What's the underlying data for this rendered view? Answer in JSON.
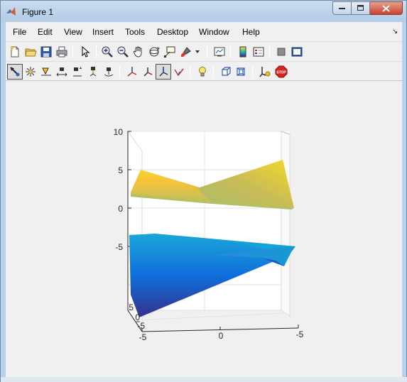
{
  "window": {
    "title": "Figure 1"
  },
  "menu": [
    "File",
    "Edit",
    "View",
    "Insert",
    "Tools",
    "Desktop",
    "Window",
    "Help"
  ],
  "toolbar1": [
    {
      "name": "new-figure-icon",
      "tooltip": ""
    },
    {
      "name": "open-file-icon",
      "tooltip": ""
    },
    {
      "name": "save-icon",
      "tooltip": ""
    },
    {
      "name": "print-icon",
      "tooltip": ""
    },
    {
      "name": "edit-plot-arrow-icon",
      "tooltip": ""
    },
    {
      "name": "zoom-in-icon",
      "tooltip": ""
    },
    {
      "name": "zoom-out-icon",
      "tooltip": ""
    },
    {
      "name": "pan-hand-icon",
      "tooltip": ""
    },
    {
      "name": "rotate-3d-icon",
      "tooltip": ""
    },
    {
      "name": "data-cursor-icon",
      "tooltip": ""
    },
    {
      "name": "brush-icon",
      "tooltip": ""
    },
    {
      "name": "link-plot-icon",
      "tooltip": ""
    },
    {
      "name": "colorbar-icon",
      "tooltip": ""
    },
    {
      "name": "legend-icon",
      "tooltip": ""
    },
    {
      "name": "hide-plot-tools-icon",
      "tooltip": ""
    },
    {
      "name": "show-plot-tools-icon",
      "tooltip": ""
    }
  ],
  "toolbar2": [
    "orbit-camera-icon",
    "orbit-scene-light-icon",
    "pan-tilt-camera-icon",
    "move-camera-horizontal-icon",
    "move-camera-forward-icon",
    "zoom-camera-icon",
    "roll-camera-icon",
    "principal-axis-x-icon",
    "principal-axis-y-icon",
    "principal-axis-z-icon",
    "principal-axis-none-icon",
    "toggle-scene-light-icon",
    "orthographic-projection-icon",
    "perspective-projection-icon",
    "reset-camera-icon",
    "stop-camera-icon"
  ],
  "chart_data": {
    "type": "surface",
    "title": "",
    "zlabel": "",
    "z_ticks": [
      "10",
      "5",
      "0",
      "-5"
    ],
    "x_ticks": [
      "-5",
      "0",
      "-5"
    ],
    "y_ticks": [
      "5",
      "0",
      "-5"
    ],
    "zlim": [
      -10,
      10
    ],
    "grid": true,
    "colormap": "parula",
    "colors": {
      "high": "#f9e51b",
      "mid": "#23b8b0",
      "low": "#352a87"
    },
    "surfaces": [
      {
        "region": "upper",
        "z_range": [
          2,
          7
        ]
      },
      {
        "region": "lower",
        "z_range": [
          -10,
          -3
        ]
      }
    ]
  }
}
